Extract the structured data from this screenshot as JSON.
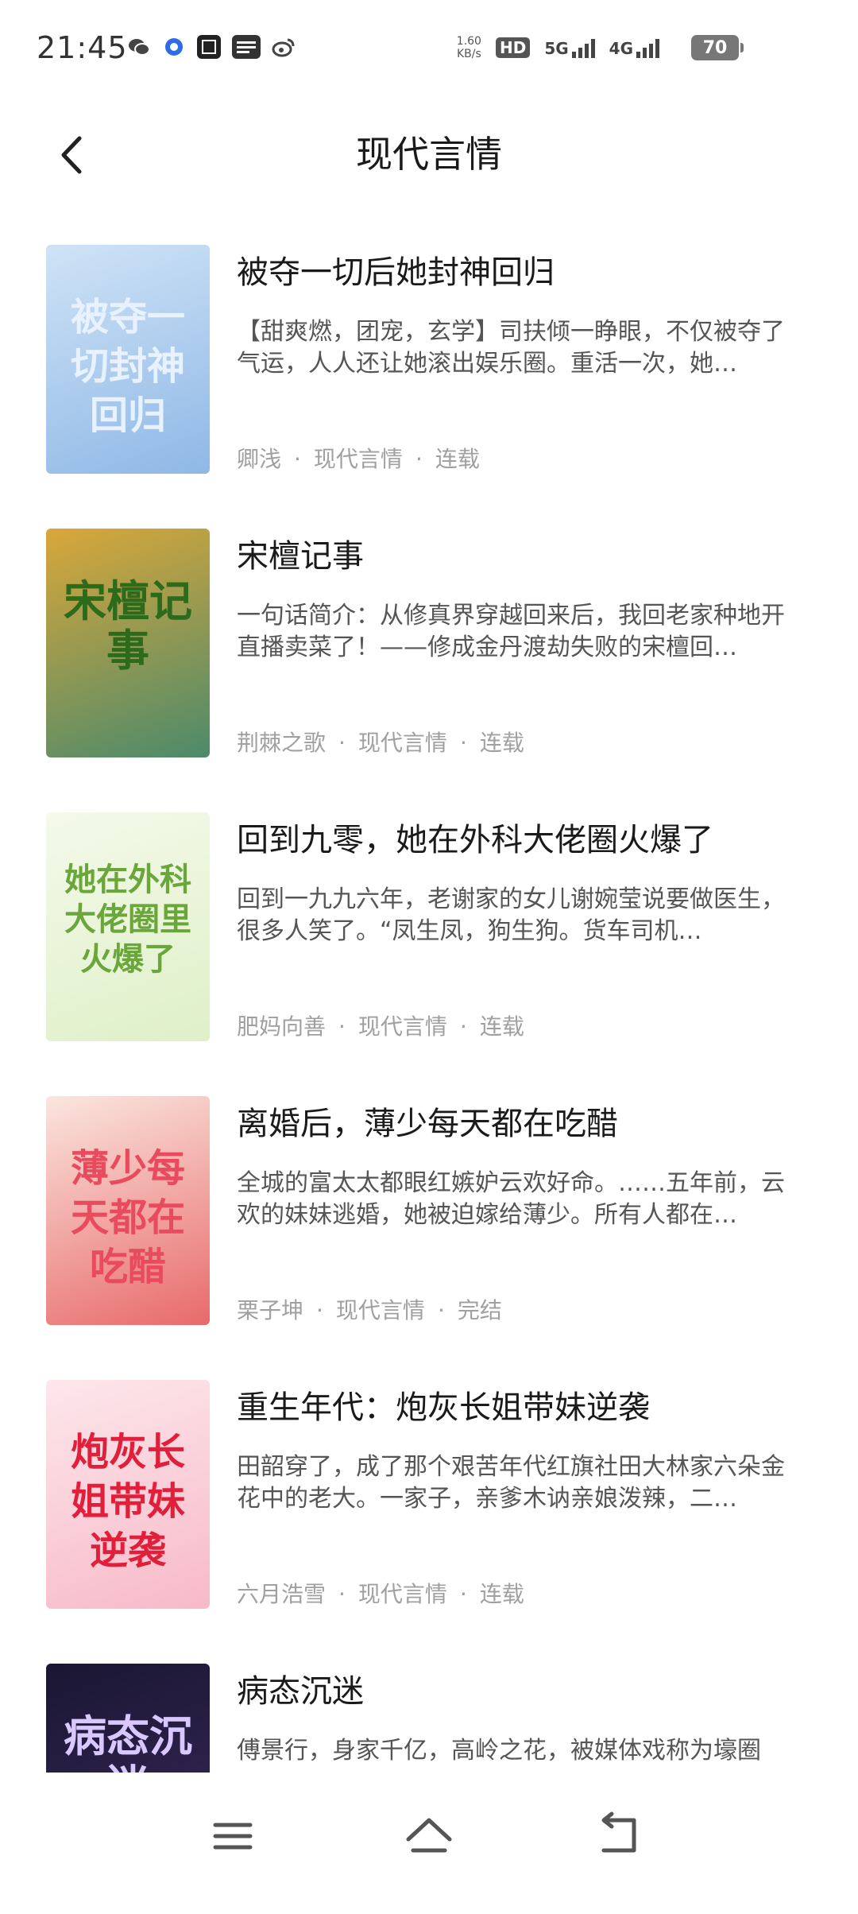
{
  "status_bar": {
    "time": "21:45",
    "net_speed": "1.60",
    "net_unit": "KB/s",
    "hd_label": "HD",
    "net1": "5G",
    "net2": "4G",
    "battery": "70",
    "left_icons": [
      "wechat-icon",
      "browser-icon",
      "app-icon",
      "toutiao-icon",
      "weibo-icon"
    ]
  },
  "header": {
    "title": "现代言情"
  },
  "books": [
    {
      "title": "被夺一切后她封神回归",
      "description": "【甜爽燃，团宠，玄学】司扶倾一睁眼，不仅被夺了气运，人人还让她滚出娱乐圈。重活一次，她…",
      "author": "卿浅",
      "category": "现代言情",
      "status": "连载",
      "cover_text": "被夺一切封神回归",
      "cover_colors": [
        "#cfe3f6",
        "#8fb8e6"
      ],
      "cover_text_color": "#e8f2ff"
    },
    {
      "title": "宋檀记事",
      "description": "一句话简介：从修真界穿越回来后，我回老家种地开直播卖菜了！——修成金丹渡劫失败的宋檀回…",
      "author": "荆棘之歌",
      "category": "现代言情",
      "status": "连载",
      "cover_text": "宋檀记事",
      "cover_colors": [
        "#d9a73a",
        "#4c8a6b"
      ],
      "cover_text_color": "#2c6a1c"
    },
    {
      "title": "回到九零，她在外科大佬圈火爆了",
      "description": "回到一九九六年，老谢家的女儿谢婉莹说要做医生，很多人笑了。“凤生凤，狗生狗。货车司机…",
      "author": "肥妈向善",
      "category": "现代言情",
      "status": "连载",
      "cover_text": "她在外科大佬圈里火爆了",
      "cover_colors": [
        "#f4f9ea",
        "#dff0c8"
      ],
      "cover_text_color": "#6aa63a"
    },
    {
      "title": "离婚后，薄少每天都在吃醋",
      "description": "全城的富太太都眼红嫉妒云欢好命。……五年前，云欢的妹妹逃婚，她被迫嫁给薄少。所有人都在…",
      "author": "栗子坤",
      "category": "现代言情",
      "status": "完结",
      "cover_text": "薄少每天都在吃醋",
      "cover_colors": [
        "#fbe6df",
        "#e86a6a"
      ],
      "cover_text_color": "#e94b5e"
    },
    {
      "title": "重生年代：炮灰长姐带妹逆袭",
      "description": "田韶穿了，成了那个艰苦年代红旗社田大林家六朵金花中的老大。一家子，亲爹木讷亲娘泼辣，二…",
      "author": "六月浩雪",
      "category": "现代言情",
      "status": "连载",
      "cover_text": "炮灰长姐带妹逆袭",
      "cover_colors": [
        "#fde7ec",
        "#f7b9c8"
      ],
      "cover_text_color": "#e0203a"
    },
    {
      "title": "病态沉迷",
      "description": "傅景行，身家千亿，高岭之花，被媒体戏称为壕圈",
      "author": "",
      "category": "",
      "status": "",
      "cover_text": "病态沉迷",
      "cover_colors": [
        "#1a1633",
        "#3a2a5a"
      ],
      "cover_text_color": "#d9c7ff"
    }
  ],
  "nav": {
    "menu_icon": "menu-icon",
    "home_icon": "home-icon",
    "back_icon": "back-icon"
  }
}
